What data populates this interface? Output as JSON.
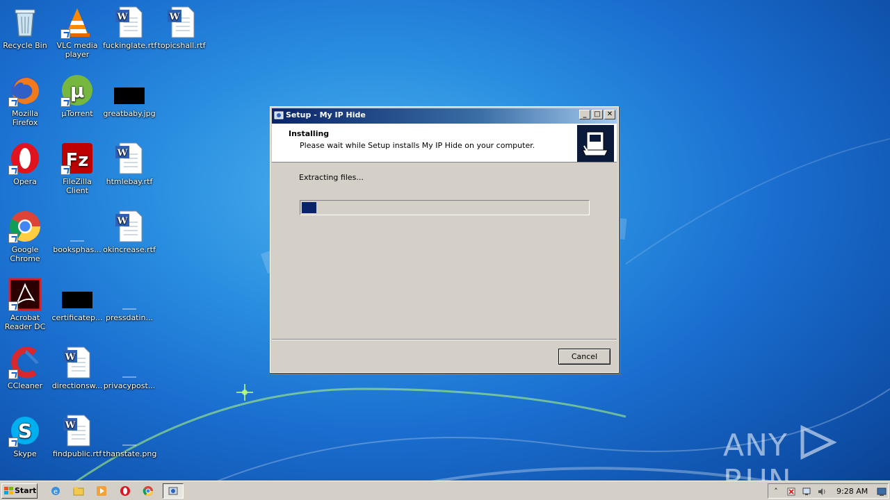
{
  "desktop": {
    "icons": [
      {
        "label": "Recycle Bin"
      },
      {
        "label": "VLC media player"
      },
      {
        "label": "fuckinglate.rtf"
      },
      {
        "label": "topicshall.rtf"
      },
      {
        "label": "Mozilla Firefox"
      },
      {
        "label": "µTorrent"
      },
      {
        "label": "greatbaby.jpg"
      },
      {
        "label": "Opera"
      },
      {
        "label": "FileZilla Client"
      },
      {
        "label": "htmlebay.rtf"
      },
      {
        "label": "Google Chrome"
      },
      {
        "label": "booksphas..."
      },
      {
        "label": "okincrease.rtf"
      },
      {
        "label": "Acrobat Reader DC"
      },
      {
        "label": "certificatep..."
      },
      {
        "label": "pressdatin..."
      },
      {
        "label": "CCleaner"
      },
      {
        "label": "directionsw..."
      },
      {
        "label": "privacypost..."
      },
      {
        "label": "Skype"
      },
      {
        "label": "findpublic.rtf"
      },
      {
        "label": "thanstate.png"
      }
    ]
  },
  "window": {
    "title": "Setup - My IP Hide",
    "header_title": "Installing",
    "header_subtitle": "Please wait while Setup installs My IP Hide on your computer.",
    "status": "Extracting files...",
    "progress": 0.05,
    "cancel_label": "Cancel",
    "min_glyph": "_",
    "max_glyph": "□",
    "close_glyph": "✕"
  },
  "taskbar": {
    "start_label": "Start",
    "clock": "9:28 AM"
  },
  "watermark": {
    "text_left": "ANY",
    "text_right": "RUN"
  },
  "colors": {
    "progress_fill": "#0a246a",
    "titlebar_start": "#0a246a"
  }
}
